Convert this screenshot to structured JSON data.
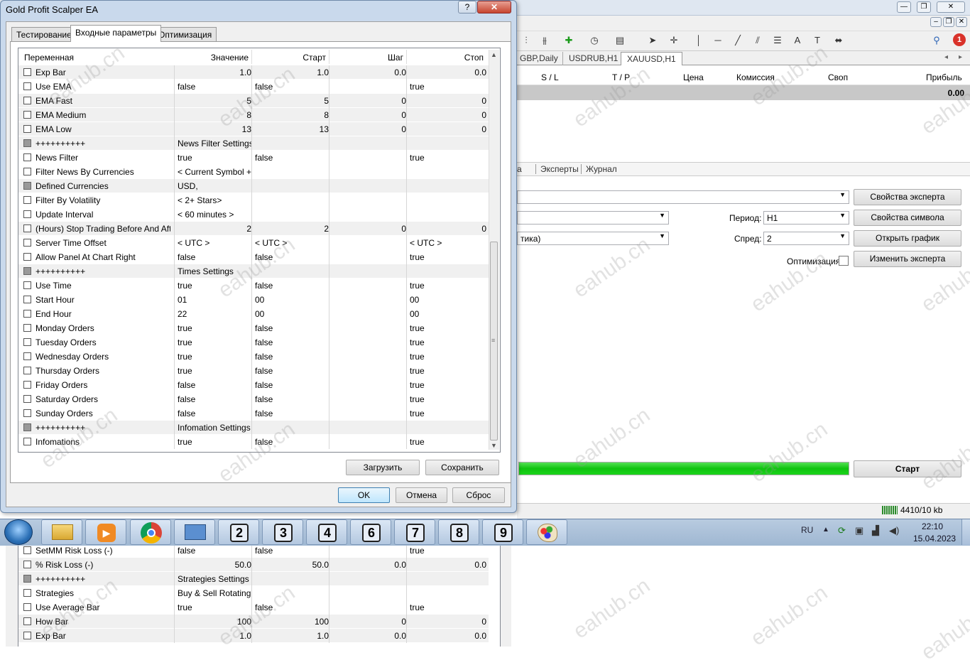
{
  "dialog": {
    "title": "Gold Profit Scalper EA",
    "help": "?",
    "close": "✕",
    "tabs": [
      "Тестирование",
      "Входные параметры",
      "Оптимизация"
    ],
    "columns": [
      "Переменная",
      "Значение",
      "Старт",
      "Шаг",
      "Стоп"
    ],
    "rows": [
      {
        "name": "Exp Bar",
        "value": "1.0",
        "start": "1.0",
        "step": "0.0",
        "stop": "0.0",
        "num": true
      },
      {
        "name": "Use EMA",
        "value": "false",
        "start": "false",
        "step": "",
        "stop": "true"
      },
      {
        "name": "EMA Fast",
        "value": "5",
        "start": "5",
        "step": "0",
        "stop": "0",
        "num": true
      },
      {
        "name": "EMA Medium",
        "value": "8",
        "start": "8",
        "step": "0",
        "stop": "0",
        "num": true
      },
      {
        "name": "EMA Low",
        "value": "13",
        "start": "13",
        "step": "0",
        "stop": "0",
        "num": true
      },
      {
        "name": "++++++++++",
        "value": "News Filter Settings",
        "start": "",
        "step": "",
        "stop": "",
        "sep": true
      },
      {
        "name": "News Filter",
        "value": "true",
        "start": "false",
        "step": "",
        "stop": "true"
      },
      {
        "name": "Filter News By Currencies",
        "value": "< Current Symbol + ...",
        "start": "",
        "step": "",
        "stop": ""
      },
      {
        "name": "Defined Currencies",
        "value": "USD,",
        "start": "",
        "step": "",
        "stop": "",
        "sep": true
      },
      {
        "name": "Filter By Volatility",
        "value": "< 2+ Stars>",
        "start": "",
        "step": "",
        "stop": ""
      },
      {
        "name": "Update Interval",
        "value": "< 60 minutes >",
        "start": "",
        "step": "",
        "stop": ""
      },
      {
        "name": "(Hours) Stop Trading Before And After...",
        "value": "2",
        "start": "2",
        "step": "0",
        "stop": "0",
        "num": true
      },
      {
        "name": "Server Time Offset",
        "value": "< UTC >",
        "start": "< UTC >",
        "step": "",
        "stop": "< UTC >"
      },
      {
        "name": "Allow Panel At Chart Right",
        "value": "false",
        "start": "false",
        "step": "",
        "stop": "true"
      },
      {
        "name": "++++++++++",
        "value": "Times Settings",
        "start": "",
        "step": "",
        "stop": "",
        "sep": true
      },
      {
        "name": "Use Time",
        "value": "true",
        "start": "false",
        "step": "",
        "stop": "true"
      },
      {
        "name": "Start Hour",
        "value": "01",
        "start": "00",
        "step": "",
        "stop": "00"
      },
      {
        "name": "End Hour",
        "value": "22",
        "start": "00",
        "step": "",
        "stop": "00"
      },
      {
        "name": "Monday Orders",
        "value": "true",
        "start": "false",
        "step": "",
        "stop": "true"
      },
      {
        "name": "Tuesday Orders",
        "value": "true",
        "start": "false",
        "step": "",
        "stop": "true"
      },
      {
        "name": "Wednesday Orders",
        "value": "true",
        "start": "false",
        "step": "",
        "stop": "true"
      },
      {
        "name": "Thursday Orders",
        "value": "true",
        "start": "false",
        "step": "",
        "stop": "true"
      },
      {
        "name": "Friday Orders",
        "value": "false",
        "start": "false",
        "step": "",
        "stop": "true"
      },
      {
        "name": "Saturday Orders",
        "value": "false",
        "start": "false",
        "step": "",
        "stop": "true"
      },
      {
        "name": "Sunday Orders",
        "value": "false",
        "start": "false",
        "step": "",
        "stop": "true"
      },
      {
        "name": "++++++++++",
        "value": "Infomation Settings",
        "start": "",
        "step": "",
        "stop": "",
        "sep": true
      },
      {
        "name": "Infomations",
        "value": "true",
        "start": "false",
        "step": "",
        "stop": "true"
      }
    ],
    "load": "Загрузить",
    "save": "Сохранить",
    "ok": "OK",
    "cancel": "Отмена",
    "reset": "Сброс"
  },
  "lower_rows": [
    {
      "name": "SetMM Risk Loss (-)",
      "value": "false",
      "start": "false",
      "step": "",
      "stop": "true"
    },
    {
      "name": "% Risk Loss (-)",
      "value": "50.0",
      "start": "50.0",
      "step": "0.0",
      "stop": "0.0",
      "num": true
    },
    {
      "name": "++++++++++",
      "value": "Strategies Settings",
      "start": "",
      "step": "",
      "stop": "",
      "sep": true
    },
    {
      "name": "Strategies",
      "value": "Buy & Sell Rotating",
      "start": "",
      "step": "",
      "stop": ""
    },
    {
      "name": "Use Average Bar",
      "value": "true",
      "start": "false",
      "step": "",
      "stop": "true"
    },
    {
      "name": "How Bar",
      "value": "100",
      "start": "100",
      "step": "0",
      "stop": "0",
      "num": true
    },
    {
      "name": "Exp Bar",
      "value": "1.0",
      "start": "1.0",
      "step": "0.0",
      "stop": "0.0",
      "num": true
    }
  ],
  "terminal": {
    "chart_tabs": [
      "GBP,Daily",
      "USDRUB,H1",
      "XAUUSD,H1"
    ],
    "trade_cols": [
      "S / L",
      "T / P",
      "Цена",
      "Комиссия",
      "Своп",
      "Прибыль"
    ],
    "total_profit": "0.00",
    "bottom_tabs": [
      "а",
      "Эксперты",
      "Журнал"
    ],
    "period_label": "Период:",
    "period_value": "H1",
    "spread_label": "Спред:",
    "spread_value": "2",
    "optimization_label": "Оптимизация",
    "model_value": "тика)",
    "btn_expert_props": "Свойства эксперта",
    "btn_symbol_props": "Свойства символа",
    "btn_open_chart": "Открыть график",
    "btn_modify_expert": "Изменить эксперта",
    "btn_start": "Старт",
    "status_traffic": "4410/10 kb",
    "notif_count": "1"
  },
  "taskbar": {
    "numbers": [
      "2",
      "3",
      "4",
      "6",
      "7",
      "8",
      "9"
    ],
    "lang": "RU",
    "time": "22:10",
    "date": "15.04.2023"
  },
  "watermark": "eahub.cn",
  "colors": {
    "progress": "#1bd41b",
    "accent": "#6f8aaa"
  }
}
